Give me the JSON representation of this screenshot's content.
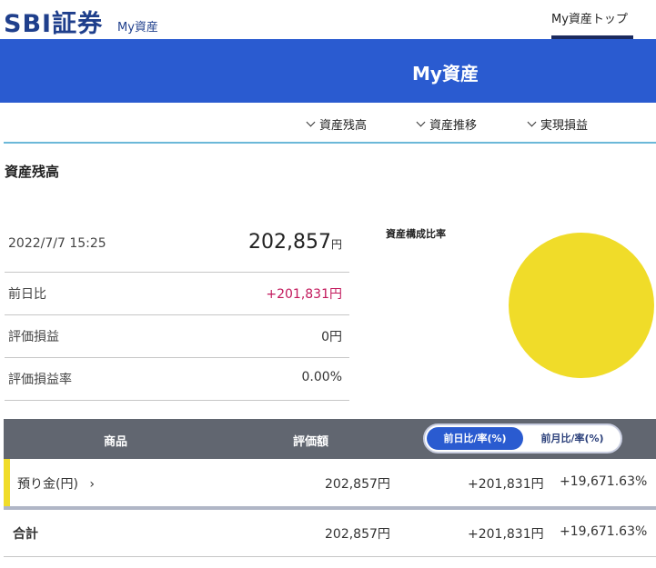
{
  "header": {
    "logo": "SBI証券",
    "sub_label": "My資産",
    "top_link": "My資産トップ"
  },
  "banner": {
    "title": "My資産"
  },
  "section_nav": [
    {
      "label": "資産残高"
    },
    {
      "label": "資産推移"
    },
    {
      "label": "実現損益"
    }
  ],
  "section_title": "資産残高",
  "summary": {
    "datetime": "2022/7/7 15:25",
    "total_value": "202,857",
    "yen": "円",
    "rows": [
      {
        "label": "前日比",
        "value": "+201,831円"
      },
      {
        "label": "評価損益",
        "value": "0円"
      },
      {
        "label": "評価損益率",
        "value": "0.00%"
      }
    ]
  },
  "composition": {
    "title": "資産構成比率",
    "slices": [
      {
        "name": "預り金(円)",
        "share": 100,
        "color": "#f0dc29"
      }
    ]
  },
  "table": {
    "headers": {
      "product": "商品",
      "valuation": "評価額"
    },
    "toggle": {
      "active": "前日比/率(%)",
      "inactive": "前月比/率(%)"
    },
    "rows": [
      {
        "product": "預り金(円)",
        "valuation": "202,857円",
        "change": "+201,831円",
        "rate": "+19,671.63%"
      }
    ],
    "total": {
      "label": "合計",
      "valuation": "202,857円",
      "change": "+201,831円",
      "rate": "+19,671.63%"
    }
  },
  "colors": {
    "brand": "#1f3f8c",
    "banner": "#2a5bd0",
    "positive": "#c2185b",
    "asset_yellow": "#f0dc29"
  }
}
